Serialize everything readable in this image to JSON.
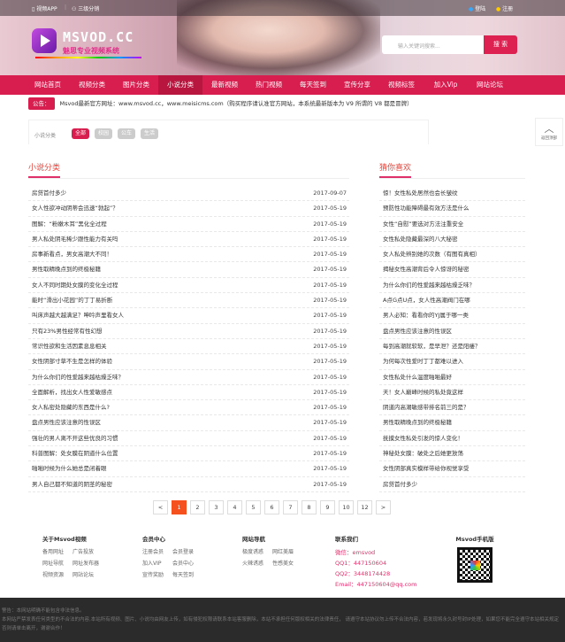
{
  "topbar": {
    "app": "视频APP",
    "dist": "三级分销",
    "login": "登陆",
    "register": "注册"
  },
  "brand": {
    "name": "MSVOD.CC",
    "slogan": "魅思专业视频系统"
  },
  "search": {
    "placeholder": "输入关键词搜索...",
    "button": "搜 索"
  },
  "nav": [
    "网站首页",
    "视频分类",
    "图片分类",
    "小说分类",
    "最新视频",
    "热门视频",
    "每天签到",
    "宣传分享",
    "视频标签",
    "加入Vip",
    "网站论坛"
  ],
  "notice": {
    "tag": "公告：",
    "text": "Msvod最新官方网址：www.msvod.cc，www.meisicms.com（购买程序请认准官方网站，本系统最新版本为 V9  所谓的 V8 都是冒牌）"
  },
  "filter": {
    "label": "小说分类",
    "options": [
      "全部",
      "校园",
      "公车",
      "生活"
    ]
  },
  "totop": {
    "label": "返回顶部"
  },
  "left": {
    "title": "小说分类",
    "items": [
      {
        "t": "房贷首付多少",
        "d": "2017-09-07"
      },
      {
        "t": "女人性欲冲动阴蒂会迅速“勃起”？",
        "d": "2017-05-19"
      },
      {
        "t": "图解：“粉嫩木耳”黑化全过程",
        "d": "2017-05-19"
      },
      {
        "t": "男人私处阴毛稀少跟性能力有关吗",
        "d": "2017-05-19"
      },
      {
        "t": "房事新看点，男女高潮大不同！",
        "d": "2017-05-19"
      },
      {
        "t": "男性取精晚点到的终极秘籍",
        "d": "2017-05-19"
      },
      {
        "t": "女人不同时期处女膜的变化全过程",
        "d": "2017-05-19"
      },
      {
        "t": "能时“滑出小花园”的丁丁易折断",
        "d": "2017-05-19"
      },
      {
        "t": "叫床声越大越满足？呻吟声里看女人",
        "d": "2017-05-19"
      },
      {
        "t": "只有23%男性经常有性幻想",
        "d": "2017-05-19"
      },
      {
        "t": "常识性欲和生活因素息息相关",
        "d": "2017-05-19"
      },
      {
        "t": "女性阴部寸草不生是怎样的体验",
        "d": "2017-05-19"
      },
      {
        "t": "为什么你们的性爱越来越枯燥乏味？",
        "d": "2017-05-19"
      },
      {
        "t": "全面解析，找出女人性爱敏感点",
        "d": "2017-05-19"
      },
      {
        "t": "女人私密处隐藏的东西是什么?",
        "d": "2017-05-19"
      },
      {
        "t": "盘点男性应该注意的性误区",
        "d": "2017-05-19"
      },
      {
        "t": "强壮的男人离不开这些优良的习惯",
        "d": "2017-05-19"
      },
      {
        "t": "科普图解：处女膜在阴道什么位置",
        "d": "2017-05-19"
      },
      {
        "t": "啪啪时候为什么她总是闭着眼",
        "d": "2017-05-19"
      },
      {
        "t": "男人自己都不知道的阴茎的秘密",
        "d": "2017-05-19"
      }
    ]
  },
  "right": {
    "title": "猜你喜欢",
    "items": [
      "惊！女性私处居然也会长皱纹",
      "预防性功能障碍最有效方法是什么",
      "女性“自慰”要选对方法注重安全",
      "女性私处隐藏最深的八大秘密",
      "女人私处辨别她的次数（有图有真相）",
      "揭秘女性高潮背后令人惊讶的秘密",
      "为什么你们的性爱越来越枯燥乏味？",
      "A点G点U点，女人性高潮阀门在哪",
      "男人必知：看看你的YJ属于哪一类",
      "盘点男性应该注意的性误区",
      "每到高潮就软软，是早泄？还是阳痿？",
      "为何每次性爱时丁丁都难以进入",
      "女性私处什么温度啪啪最好",
      "天！女人巅峰时候的私处竟这样",
      "阴道内高潮敏感带排名前三的是？",
      "男性取精晚点到的终极秘籍",
      "抚摸女性私处引发的惊人变化！",
      "神秘处女膜：破处之后她更放荡",
      "女性阴部真实模样带给你视觉享受",
      "房贷首付多少"
    ]
  },
  "pager": [
    "<",
    "1",
    "2",
    "3",
    "4",
    "5",
    "6",
    "7",
    "8",
    "9",
    "10",
    "12",
    ">"
  ],
  "footer": {
    "about": {
      "title": "关于Msvod视频",
      "links": [
        "备用网址",
        "广告投放",
        "网址导航",
        "网址发布器",
        "视频资源",
        "网站论坛"
      ]
    },
    "member": {
      "title": "会员中心",
      "links": [
        "注册会员",
        "会员登录",
        "加入VIP",
        "会员中心",
        "宣传奖励",
        "每天签到"
      ]
    },
    "nav": {
      "title": "网站导航",
      "links": [
        "极度诱惑",
        "网红美眉",
        "火辣诱惑",
        "性感美女"
      ]
    },
    "contact": {
      "title": "联系我们",
      "lines": [
        "微信：emsvod",
        "QQ1：447150604",
        "QQ2：3448174428",
        "Email：447150604@qq.com"
      ]
    },
    "mobile": {
      "title": "Msvod手机版"
    }
  },
  "disclaimer": [
    "警告：本网站明确不能包含非法信息。",
    "本网站严禁发表任何类型的不合法的内容,本站所有视频、图片、小说均由网友上传，如有侵犯权限请联系本站客服删除，本站不承担任何版权相关的法律责任， 请遵守本站协议勿上传不合法内容，若发现将永久封号封IP处理，如果您不能完全遵守本站相关规定否则请单击离开，谢谢合作！"
  ]
}
